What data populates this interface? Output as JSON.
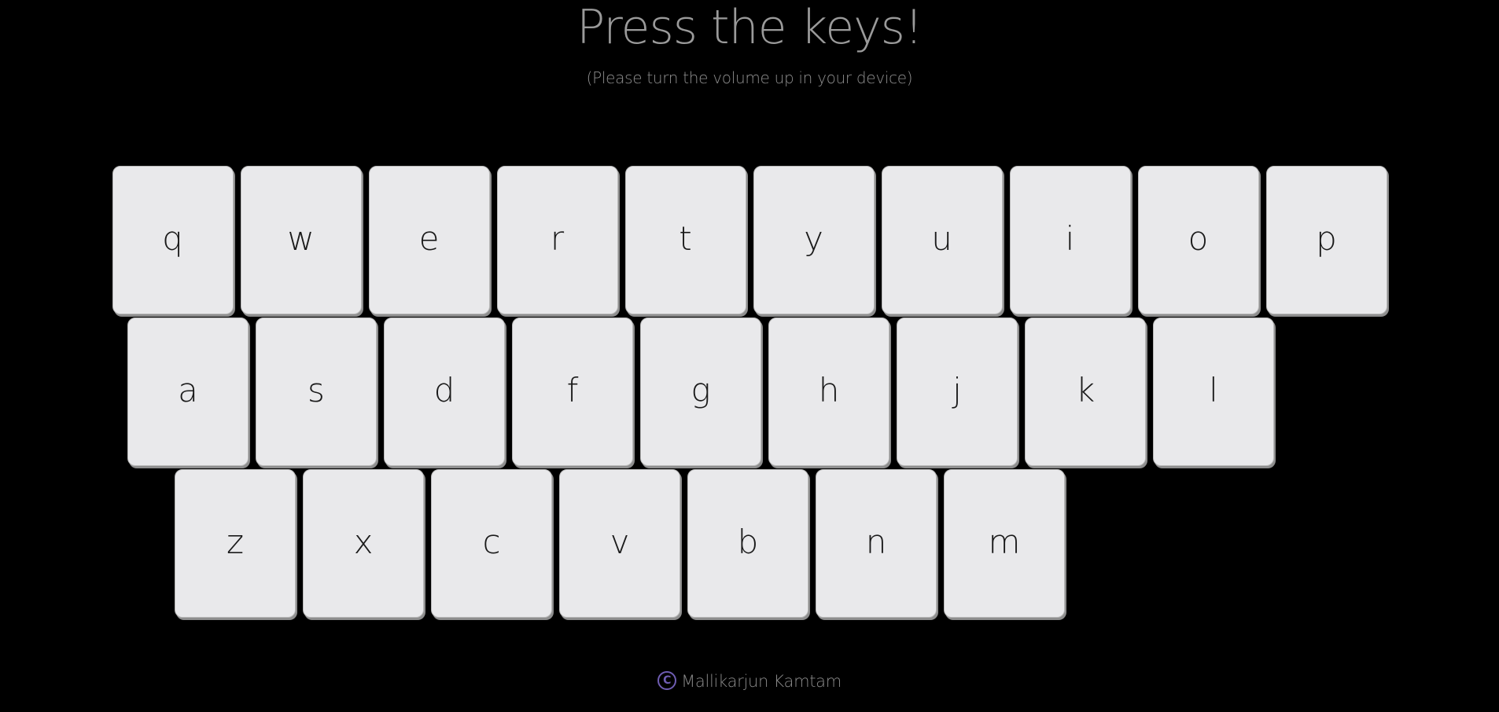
{
  "header": {
    "title": "Press the keys!",
    "subtitle": "(Please turn the volume up in your device)"
  },
  "keyboard": {
    "rows": [
      [
        "q",
        "w",
        "e",
        "r",
        "t",
        "y",
        "u",
        "i",
        "o",
        "p"
      ],
      [
        "a",
        "s",
        "d",
        "f",
        "g",
        "h",
        "j",
        "k",
        "l"
      ],
      [
        "z",
        "x",
        "c",
        "v",
        "b",
        "n",
        "m"
      ]
    ]
  },
  "footer": {
    "icon": "copyright-icon",
    "icon_glyph": "C",
    "author": "Mallikarjun Kamtam"
  },
  "colors": {
    "background": "#000000",
    "key": "#e9e9eb",
    "accent": "#6f5db3"
  }
}
